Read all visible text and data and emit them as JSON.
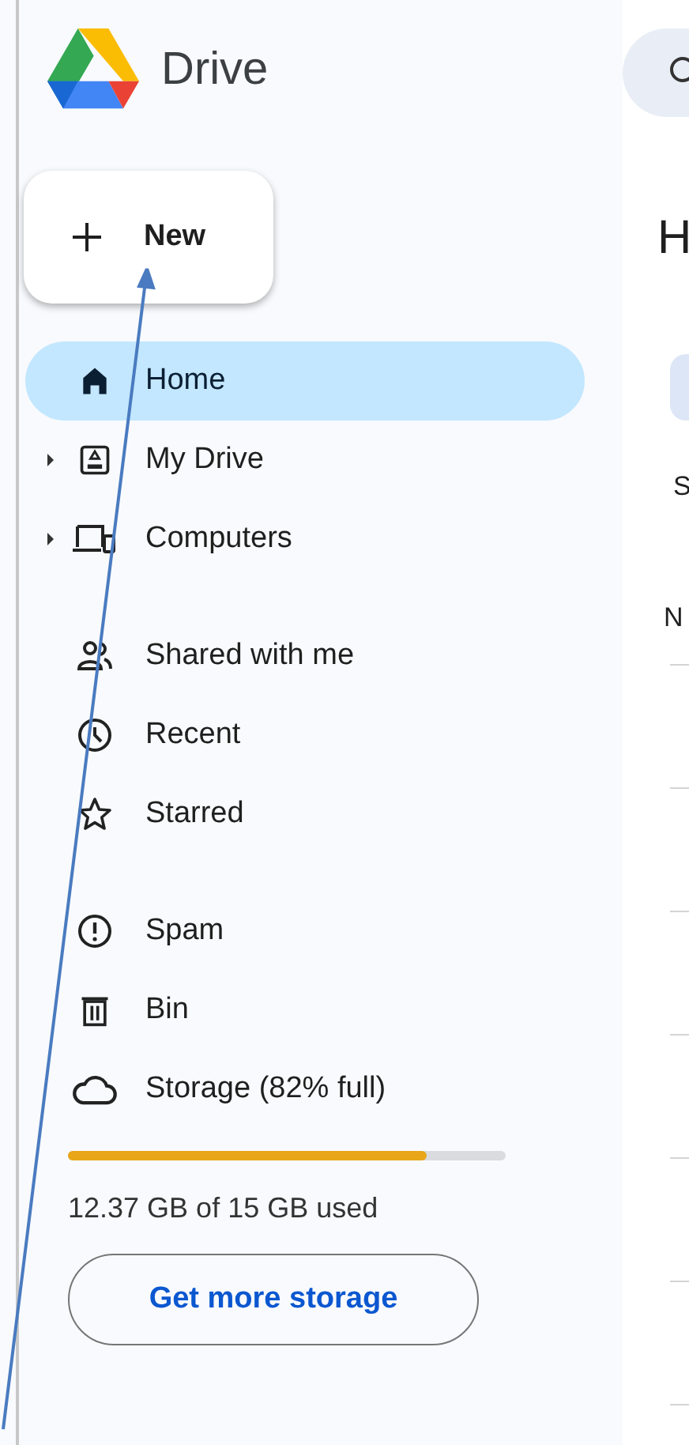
{
  "app": {
    "title": "Drive"
  },
  "new_button": {
    "label": "New"
  },
  "nav_groups": [
    [
      {
        "label": "Home",
        "kind": "home",
        "selected": true,
        "expandable": false
      },
      {
        "label": "My Drive",
        "kind": "drive",
        "selected": false,
        "expandable": true
      },
      {
        "label": "Computers",
        "kind": "computers",
        "selected": false,
        "expandable": true
      }
    ],
    [
      {
        "label": "Shared with me",
        "kind": "shared",
        "selected": false,
        "expandable": false
      },
      {
        "label": "Recent",
        "kind": "recent",
        "selected": false,
        "expandable": false
      },
      {
        "label": "Starred",
        "kind": "starred",
        "selected": false,
        "expandable": false
      }
    ],
    [
      {
        "label": "Spam",
        "kind": "spam",
        "selected": false,
        "expandable": false
      },
      {
        "label": "Bin",
        "kind": "bin",
        "selected": false,
        "expandable": false
      },
      {
        "label": "Storage (82% full)",
        "kind": "storage",
        "selected": false,
        "expandable": false
      }
    ]
  ],
  "storage": {
    "level": 0.82,
    "usage": "12.37 GB of 15 GB used",
    "button": "Get more storage"
  },
  "main": {
    "heading": "H",
    "section_label": "S",
    "column_label": "N"
  }
}
